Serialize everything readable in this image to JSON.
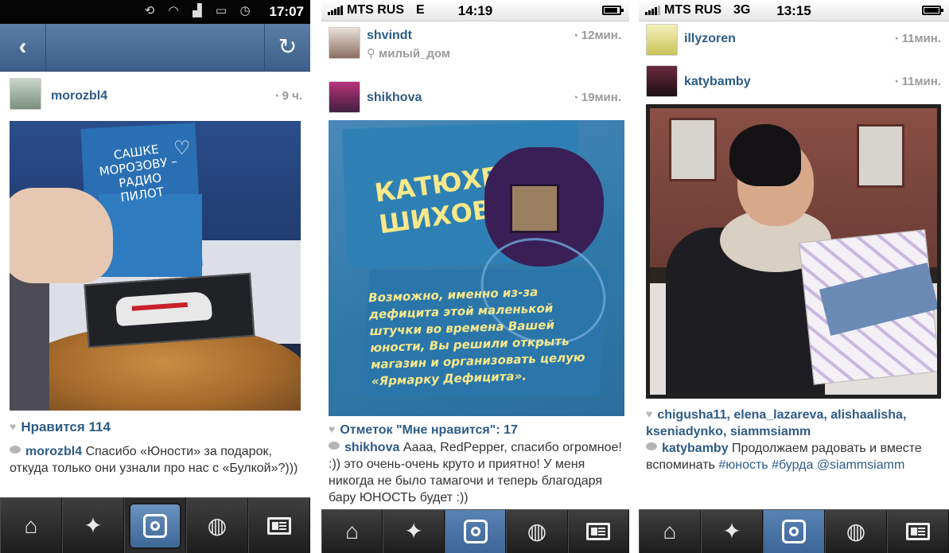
{
  "phone1": {
    "status": {
      "time": "17:07"
    },
    "post": {
      "username": "morozbl4",
      "time_ago": "9 ч.",
      "card_text": "САШКЕ МОРОЗОВУ – РАДИО ПИЛОТ",
      "likes": "Нравится 114",
      "comment_user": "morozbl4",
      "comment_text": "Спасибо «Юности» за подарок, откуда только они узнали про нас с «Булкой»?)))"
    }
  },
  "phone2": {
    "status": {
      "carrier": "MTS RUS",
      "network": "E",
      "time": "14:19"
    },
    "prev_post": {
      "username": "shvindt",
      "time_ago": "12мин.",
      "location": "милый_дом"
    },
    "post": {
      "username": "shikhova",
      "time_ago": "19мин.",
      "card_title_line1": "КАТЮХЕ",
      "card_title_line2": "ШИХОВОЙ",
      "card_body": "Возможно, именно из-за дефицита этой маленькой штучки во времена Вашей юности, Вы решили открыть магазин и организовать целую «Ярмарку Дефицита».",
      "likes": "Отметок \"Мне нравится\": 17",
      "comment_user": "shikhova",
      "comment_text": "Аааа, RedPepper, спасибо огромное! :)) это очень-очень круто и приятно! У меня никогда не было тамагочи и теперь благодаря бару ЮНОСТЬ будет :))"
    }
  },
  "phone3": {
    "status": {
      "carrier": "MTS RUS",
      "network": "3G",
      "time": "13:15"
    },
    "prev_post": {
      "username": "illyzoren",
      "time_ago": "11мин."
    },
    "post": {
      "username": "katybamby",
      "time_ago": "11мин.",
      "likers": [
        "chigusha11",
        "elena_lazareva",
        "alishaalisha",
        "kseniadynko",
        "siammsiamm"
      ],
      "comment_user": "katybamby",
      "comment_text": "Продолжаем радовать и вместе вспоминать",
      "comment_tags": "#юность #бурда @siammsiamm"
    }
  },
  "tabs": {
    "home": "home-icon",
    "popular": "star-icon",
    "camera": "camera-icon",
    "activity": "speech-bubble-icon",
    "profile": "news-card-icon"
  },
  "colors": {
    "username_blue": "#2d5b87",
    "nav_blue": "#4a6f9a",
    "tab_active_blue": "#4a75a8",
    "tabbar_dark": "#2b2b2b"
  }
}
